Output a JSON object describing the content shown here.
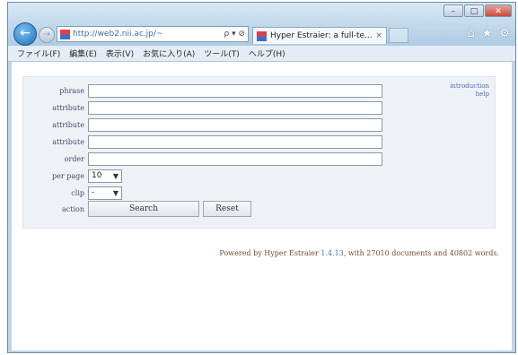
{
  "window": {
    "controls": [
      "–",
      "□",
      "✕"
    ]
  },
  "navigation": {
    "back_icon": "back-arrow-icon",
    "forward_icon": "forward-arrow-icon",
    "address": "http://web2.nii.ac.jp/~",
    "address_actions": "ρ ▾ ⊘"
  },
  "tabs": [
    {
      "title": "Hyper Estraier: a full-te...",
      "close": "×"
    }
  ],
  "toolbar_icons": [
    "home-icon",
    "star-icon",
    "gear-icon"
  ],
  "menu": [
    "ファイル(F)",
    "編集(E)",
    "表示(V)",
    "お気に入り(A)",
    "ツール(T)",
    "ヘルプ(H)"
  ],
  "form": {
    "rows": [
      {
        "label": "phrase",
        "value": ""
      },
      {
        "label": "attribute",
        "value": ""
      },
      {
        "label": "attribute",
        "value": ""
      },
      {
        "label": "attribute",
        "value": ""
      },
      {
        "label": "order",
        "value": ""
      }
    ],
    "per_page": {
      "label": "per page",
      "value": "10"
    },
    "clip": {
      "label": "clip",
      "value": "-"
    },
    "action": {
      "label": "action",
      "search": "Search",
      "reset": "Reset"
    }
  },
  "side_links": [
    "introduction",
    "help"
  ],
  "footer": {
    "prefix": "Powered by Hyper Estraier",
    "version": "1.4.13",
    "suffix": ", with 27010 documents and 40802 words."
  }
}
